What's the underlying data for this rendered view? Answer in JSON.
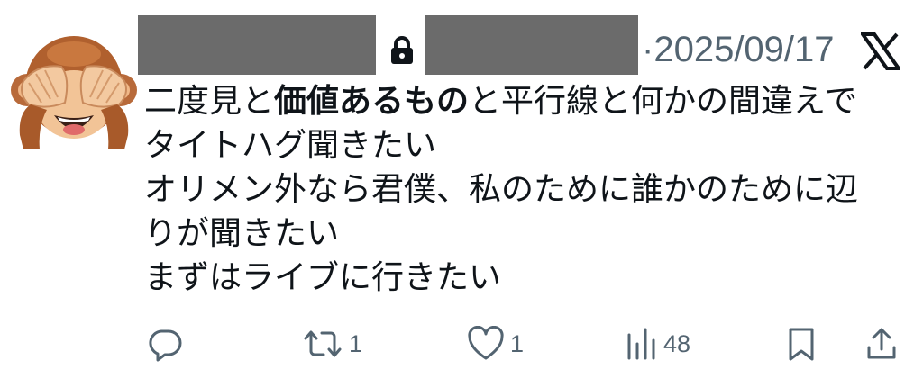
{
  "tweet": {
    "date_separator": "·",
    "date": "2025/09/17",
    "text_lines": [
      [
        {
          "t": "二度見と",
          "b": false
        },
        {
          "t": "価値あるもの",
          "b": true
        },
        {
          "t": "と平行線と何かの間違えで",
          "b": false
        }
      ],
      [
        {
          "t": "タイトハグ聞きたい",
          "b": false
        }
      ],
      [
        {
          "t": "オリメン外なら君僕、私のために誰かのために辺",
          "b": false
        }
      ],
      [
        {
          "t": "りが聞きたい",
          "b": false
        }
      ],
      [
        {
          "t": "まずはライブに行きたい",
          "b": false
        }
      ]
    ]
  },
  "actions": {
    "reply_count": "",
    "retweet_count": "1",
    "like_count": "1",
    "views_count": "48"
  },
  "icons": {
    "avatar": "see-no-evil-monkey-emoji",
    "lock": "lock-icon",
    "brand": "x-logo",
    "reply": "reply-icon",
    "retweet": "retweet-icon",
    "like": "heart-icon",
    "views": "views-icon",
    "bookmark": "bookmark-icon",
    "share": "share-icon"
  },
  "colors": {
    "text": "#0f1419",
    "muted": "#536471",
    "redaction": "#6b6b6b"
  }
}
